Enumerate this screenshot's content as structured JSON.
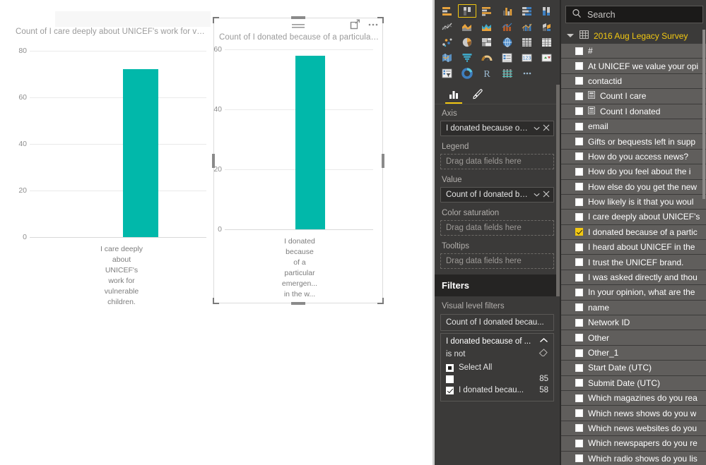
{
  "chart_data": [
    {
      "type": "bar",
      "id": "chart-care",
      "title": "Count of I care deeply about UNICEF's work for vul...",
      "categories": [
        "I care deeply about UNICEF's work for vulnerable children."
      ],
      "category_lines": [
        "I care deeply",
        "about",
        "UNICEF's",
        "work for",
        "vulnerable",
        "children."
      ],
      "values": [
        72
      ],
      "ylim": [
        0,
        80
      ],
      "yticks": [
        0,
        20,
        40,
        60,
        80
      ],
      "ylabel": "",
      "xlabel": "",
      "grid": true,
      "legend": "none",
      "color": "#01b8aa"
    },
    {
      "type": "bar",
      "id": "chart-donated",
      "title": "Count of I donated because of a particular ...",
      "categories": [
        "I donated because of a particular emergency in the world."
      ],
      "category_lines": [
        "I donated",
        "because",
        "of a",
        "particular",
        "emergen...",
        "in the w..."
      ],
      "values": [
        58
      ],
      "ylim": [
        0,
        60
      ],
      "yticks": [
        0,
        20,
        40,
        60
      ],
      "ylabel": "",
      "xlabel": "",
      "grid": true,
      "legend": "none",
      "color": "#01b8aa",
      "selected": true
    }
  ],
  "canvas": {
    "visuals": [
      {
        "title": "Count of I care deeply about UNICEF's work for vul..."
      },
      {
        "title": "Count of I donated because of a particular ..."
      }
    ],
    "visual_tools": {
      "filter_icon": "filter-hamburger-icon",
      "focus_icon": "focus-mode-icon",
      "more_icon": "more-options-ellipsis-icon"
    }
  },
  "visualizations": {
    "icons": [
      "stacked-bar-chart-icon",
      "stacked-column-chart-icon",
      "clustered-bar-chart-icon",
      "clustered-column-chart-icon",
      "hundred-percent-stacked-bar-chart-icon",
      "hundred-percent-stacked-column-chart-icon",
      "line-chart-icon",
      "area-chart-icon",
      "stacked-area-chart-icon",
      "line-and-stacked-column-chart-icon",
      "line-and-clustered-column-chart-icon",
      "ribbon-chart-icon",
      "scatter-chart-icon",
      "pie-chart-icon",
      "treemap-icon",
      "map-icon",
      "table-icon",
      "matrix-icon",
      "filled-map-icon",
      "funnel-icon",
      "gauge-icon",
      "multi-row-card-icon",
      "card-icon",
      "kpi-icon",
      "slicer-icon",
      "donut-chart-icon",
      "r-script-visual-icon",
      "python-visual-icon",
      "more-visuals-ellipsis-icon"
    ],
    "selected_icon_index": 1,
    "tabs": [
      {
        "name": "fields-tab",
        "icon": "fields-bar-chart-icon",
        "active": true
      },
      {
        "name": "format-tab",
        "icon": "format-paintbrush-icon",
        "active": false
      }
    ],
    "wells": [
      {
        "label": "Axis",
        "value": "I donated because of ...",
        "filled": true,
        "placeholder": ""
      },
      {
        "label": "Legend",
        "value": "",
        "filled": false,
        "placeholder": "Drag data fields here"
      },
      {
        "label": "Value",
        "value": "Count of I donated be...",
        "filled": true,
        "placeholder": ""
      },
      {
        "label": "Color saturation",
        "value": "",
        "filled": false,
        "placeholder": "Drag data fields here"
      },
      {
        "label": "Tooltips",
        "value": "",
        "filled": false,
        "placeholder": "Drag data fields here"
      }
    ]
  },
  "filters": {
    "header": "Filters",
    "subheader": "Visual level filters",
    "cards": [
      {
        "label": "Count of I donated becau..."
      }
    ],
    "group": {
      "title": "I donated because of ...",
      "collapse_icon": "chevron-up-icon",
      "operator": "is not",
      "clear_icon": "eraser-clear-filter-icon",
      "items": [
        {
          "label": "Select All",
          "count": "",
          "state": "partial"
        },
        {
          "label": "",
          "count": "85",
          "state": "unchecked"
        },
        {
          "label": "I donated becau...",
          "count": "58",
          "state": "checked"
        }
      ]
    }
  },
  "fields": {
    "search": {
      "placeholder": "Search",
      "value": "",
      "icon": "search-icon"
    },
    "table": {
      "name": "2016 Aug Legacy Survey",
      "icon": "table-icon",
      "expand_icon": "expanded-triangle-icon"
    },
    "items": [
      {
        "label": "#",
        "checked": false,
        "measure": false
      },
      {
        "label": "At UNICEF we value your opi",
        "checked": false,
        "measure": false
      },
      {
        "label": "contactid",
        "checked": false,
        "measure": false
      },
      {
        "label": "Count I care",
        "checked": false,
        "measure": true
      },
      {
        "label": "Count I donated",
        "checked": false,
        "measure": true
      },
      {
        "label": "email",
        "checked": false,
        "measure": false
      },
      {
        "label": "Gifts or bequests left in supp",
        "checked": false,
        "measure": false
      },
      {
        "label": "How do you access news?",
        "checked": false,
        "measure": false
      },
      {
        "label": "How do you feel about the i",
        "checked": false,
        "measure": false
      },
      {
        "label": "How else do you get the new",
        "checked": false,
        "measure": false
      },
      {
        "label": "How likely is it that you woul",
        "checked": false,
        "measure": false
      },
      {
        "label": "I care deeply about UNICEF's",
        "checked": false,
        "measure": false
      },
      {
        "label": "I donated because of a partic",
        "checked": true,
        "measure": false
      },
      {
        "label": "I heard about UNICEF in the ",
        "checked": false,
        "measure": false
      },
      {
        "label": "I trust the UNICEF brand.",
        "checked": false,
        "measure": false
      },
      {
        "label": "I was asked directly and thou",
        "checked": false,
        "measure": false
      },
      {
        "label": "In your opinion, what are the",
        "checked": false,
        "measure": false
      },
      {
        "label": "name",
        "checked": false,
        "measure": false
      },
      {
        "label": "Network ID",
        "checked": false,
        "measure": false
      },
      {
        "label": "Other",
        "checked": false,
        "measure": false
      },
      {
        "label": "Other_1",
        "checked": false,
        "measure": false
      },
      {
        "label": "Start Date (UTC)",
        "checked": false,
        "measure": false
      },
      {
        "label": "Submit Date (UTC)",
        "checked": false,
        "measure": false
      },
      {
        "label": "Which magazines do you rea",
        "checked": false,
        "measure": false
      },
      {
        "label": "Which news shows do you w",
        "checked": false,
        "measure": false
      },
      {
        "label": "Which news websites do you",
        "checked": false,
        "measure": false
      },
      {
        "label": "Which newspapers do you re",
        "checked": false,
        "measure": false
      },
      {
        "label": "Which radio shows do you lis",
        "checked": false,
        "measure": false
      }
    ]
  }
}
